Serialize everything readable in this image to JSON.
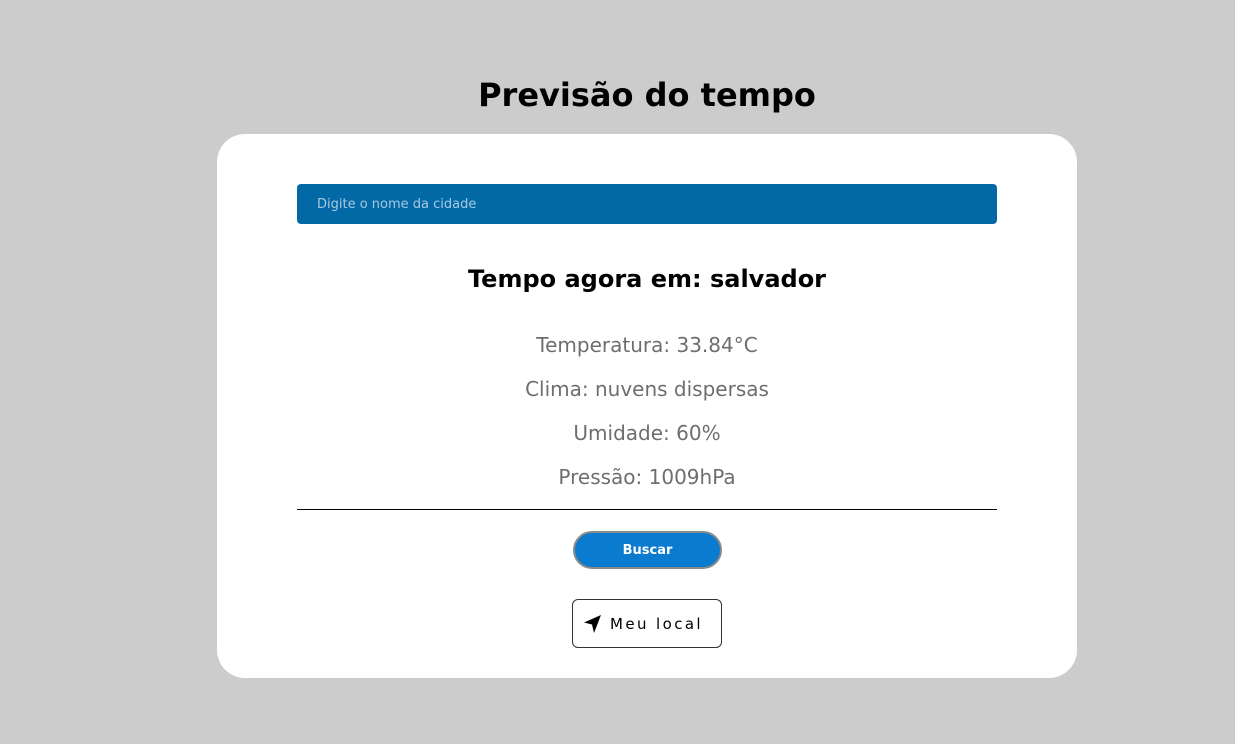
{
  "header": {
    "title": "Previsão do tempo"
  },
  "search": {
    "placeholder": "Digite o nome da cidade",
    "value": ""
  },
  "weather": {
    "heading": "Tempo agora em: salvador",
    "temperature": "Temperatura: 33.84°C",
    "climate": "Clima: nuvens dispersas",
    "humidity": "Umidade: 60%",
    "pressure": "Pressão: 1009hPa"
  },
  "actions": {
    "search_label": "Buscar",
    "location_label": "Meu local",
    "location_icon": "navigation-arrow-icon"
  },
  "colors": {
    "background": "#cccccc",
    "card": "#ffffff",
    "input_bg": "#0369a6",
    "button_bg": "#0a7bcf",
    "text_muted": "#6e6e6e"
  }
}
